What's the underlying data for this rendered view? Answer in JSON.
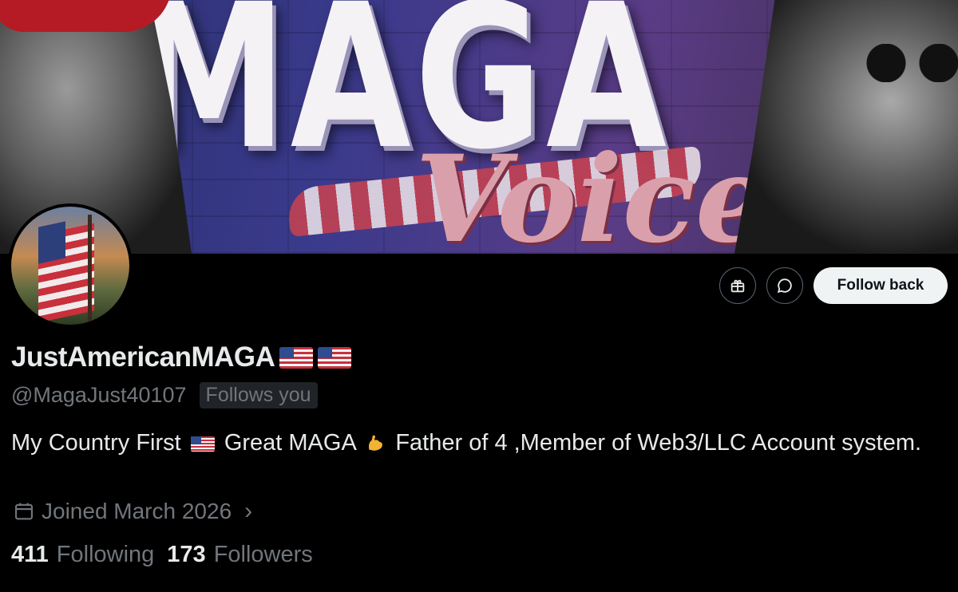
{
  "banner": {
    "headline": "MAGA",
    "script": "Voice"
  },
  "actions": {
    "gift_icon": "gift-icon",
    "message_icon": "message-icon",
    "follow_back_label": "Follow back"
  },
  "profile": {
    "display_name": "JustAmericanMAGA",
    "handle": "@MagaJust40107",
    "follows_you": "Follows you",
    "bio_part1": "My Country First",
    "bio_part2": "Great MAGA",
    "bio_part3": "Father of 4 ,Member of Web3/LLC Account system.",
    "joined": "Joined March 2026",
    "following_count": "411",
    "following_label": "Following",
    "followers_count": "173",
    "followers_label": "Followers"
  },
  "colors": {
    "background": "#000000",
    "text": "#e7e9ea",
    "muted": "#71767b",
    "button_bg": "#eff3f4"
  }
}
